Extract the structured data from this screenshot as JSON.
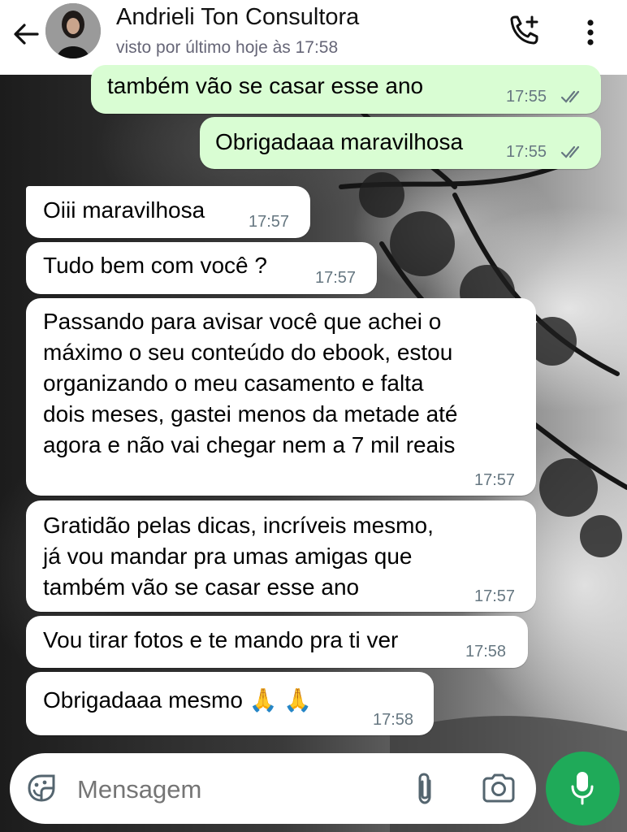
{
  "header": {
    "contact_name": "Andrieli Ton Consultora",
    "status": "visto por último hoje às 17:58",
    "icons": [
      "back-arrow-icon",
      "avatar",
      "add-call-icon",
      "more-options-icon"
    ]
  },
  "messages": [
    {
      "direction": "out",
      "text": "também vão se casar esse ano",
      "time": "17:55",
      "read": true
    },
    {
      "direction": "out",
      "text": "Obrigadaaa maravilhosa",
      "time": "17:55",
      "read": true
    },
    {
      "direction": "in",
      "text": "Oiii maravilhosa",
      "time": "17:57"
    },
    {
      "direction": "in",
      "text": "Tudo bem com você ?",
      "time": "17:57"
    },
    {
      "direction": "in",
      "text": "Passando para avisar você que achei o\nmáximo o seu conteúdo do ebook, estou\norganizando o meu casamento e falta\ndois meses, gastei menos da metade até\nagora e não vai chegar nem a 7 mil reais",
      "time": "17:57"
    },
    {
      "direction": "in",
      "text": "Gratidão pelas dicas, incríveis mesmo,\njá vou mandar pra umas amigas que\ntambém vão se casar esse ano",
      "time": "17:57"
    },
    {
      "direction": "in",
      "text": "Vou tirar fotos e te mando pra ti ver",
      "time": "17:58"
    },
    {
      "direction": "in",
      "text": "Obrigadaaa mesmo 🙏 🙏",
      "time": "17:58"
    }
  ],
  "input": {
    "placeholder": "Mensagem",
    "icons": [
      "sticker-icon",
      "attach-icon",
      "camera-icon",
      "mic-icon"
    ]
  },
  "colors": {
    "header_bg": "#ffffff",
    "outgoing_bubble": "#d9fdd3",
    "incoming_bubble": "#ffffff",
    "read_ticks": "#667781",
    "mic_button": "#1faa59"
  }
}
